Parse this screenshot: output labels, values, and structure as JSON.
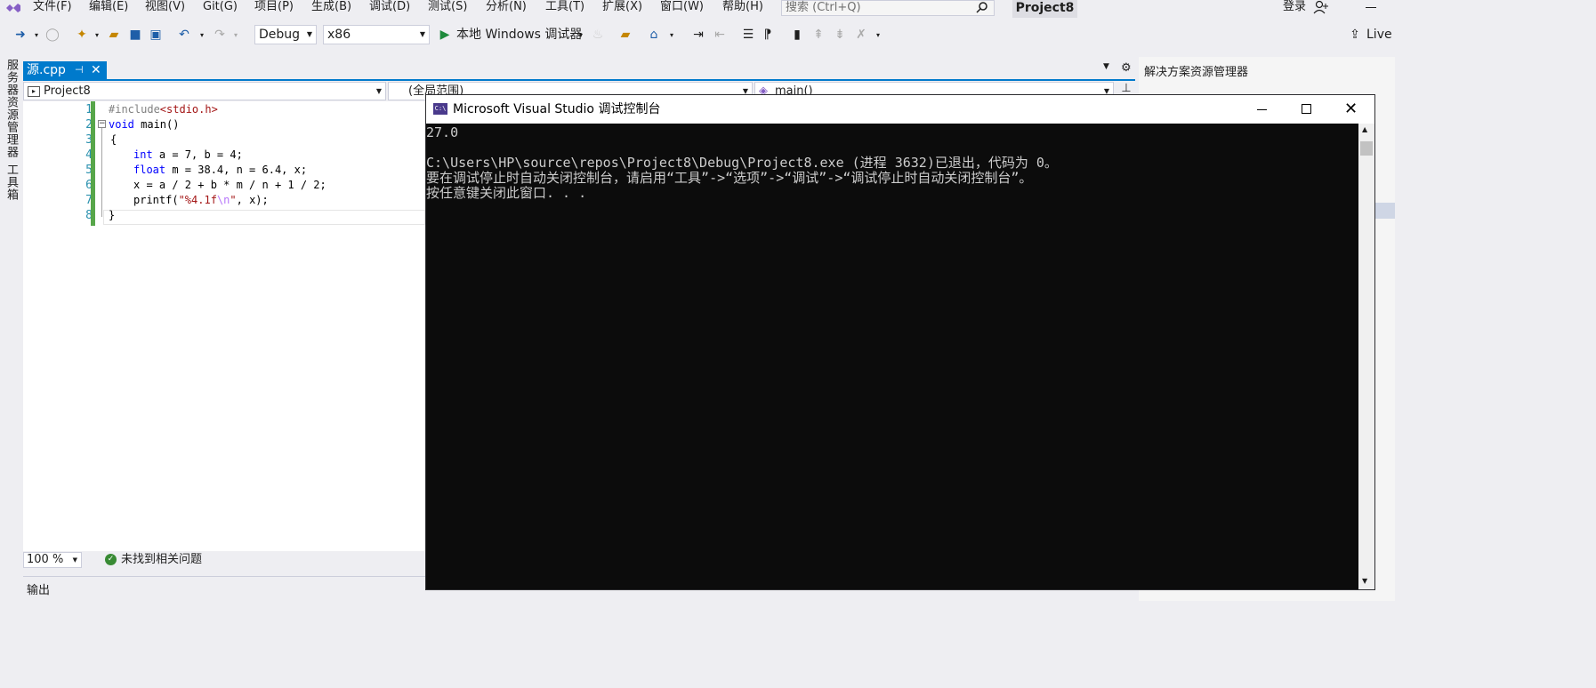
{
  "menubar": {
    "items": [
      "文件(F)",
      "编辑(E)",
      "视图(V)",
      "Git(G)",
      "项目(P)",
      "生成(B)",
      "调试(D)",
      "测试(S)",
      "分析(N)",
      "工具(T)",
      "扩展(X)",
      "窗口(W)",
      "帮助(H)"
    ],
    "search_placeholder": "搜索 (Ctrl+Q)",
    "project_title": "Project8",
    "login": "登录"
  },
  "toolbar": {
    "config": "Debug",
    "platform": "x86",
    "run_label": "本地 Windows 调试器",
    "live": "Live"
  },
  "left_sidebar": {
    "server_explorer": "服务器资源管理器",
    "toolbox": "工具箱"
  },
  "editor": {
    "tab_label": "源.cpp",
    "project_scope": "Project8",
    "global_scope": "(全局范围)",
    "member": "main()",
    "zoom": "100 %",
    "issues": "未找到相关问题",
    "lines": [
      "1",
      "2",
      "3",
      "4",
      "5",
      "6",
      "7",
      "8"
    ],
    "code": {
      "l1_pp": "#include",
      "l1_str": "<stdio.h>",
      "l2_kw": "void",
      "l2_rest": " main()",
      "l3": "{",
      "l4_kw": "int",
      "l4_rest": " a = 7, b = 4;",
      "l5_kw": "float",
      "l5_rest": " m = 38.4, n = 6.4, x;",
      "l6": "x = a / 2 + b * m / n + 1 / 2;",
      "l7_a": "printf(",
      "l7_str1": "\"%4.1f",
      "l7_esc": "\\n",
      "l7_str2": "\"",
      "l7_b": ", x);",
      "l8": "}"
    }
  },
  "output": {
    "label": "输出"
  },
  "solution_explorer": {
    "title": "解决方案资源管理器"
  },
  "console": {
    "icon_text": "C:\\",
    "title": "Microsoft Visual Studio 调试控制台",
    "output": "27.0\n\nC:\\Users\\HP\\source\\repos\\Project8\\Debug\\Project8.exe (进程 3632)已退出，代码为 0。\n要在调试停止时自动关闭控制台，请启用“工具”->“选项”->“调试”->“调试停止时自动关闭控制台”。\n按任意键关闭此窗口. . ."
  },
  "colors": {
    "accent": "#007acc",
    "console_bg": "#0c0c0c",
    "vs_purple": "#865fc5"
  }
}
